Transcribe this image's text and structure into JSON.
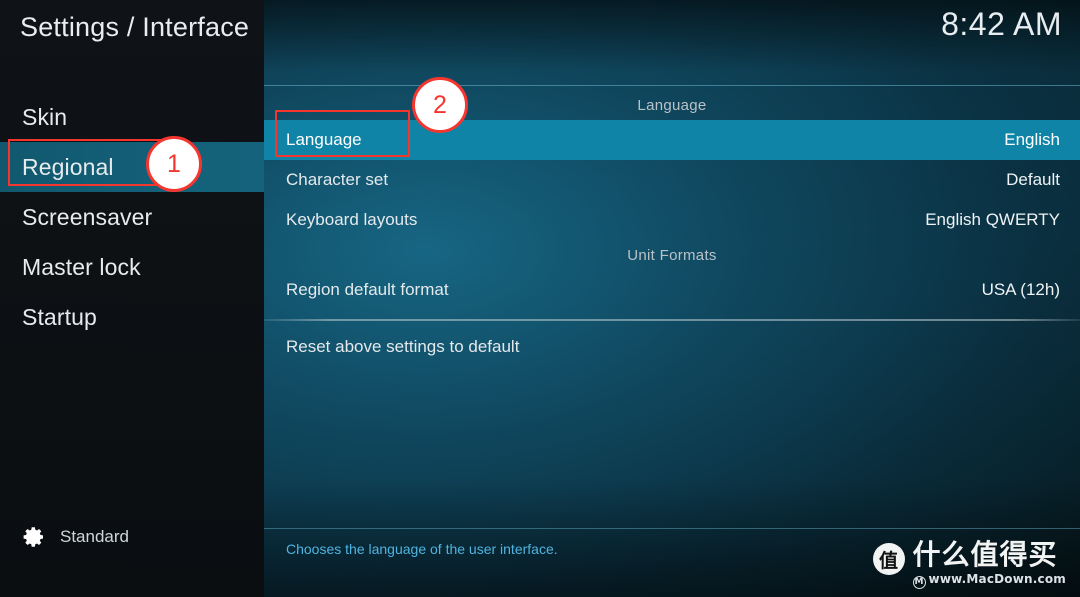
{
  "window": {
    "title": "Settings / Interface",
    "clock": "8:42 AM"
  },
  "sidebar": {
    "items": [
      {
        "label": "Skin",
        "selected": false
      },
      {
        "label": "Regional",
        "selected": true
      },
      {
        "label": "Screensaver",
        "selected": false
      },
      {
        "label": "Master lock",
        "selected": false
      },
      {
        "label": "Startup",
        "selected": false
      }
    ],
    "footer": {
      "icon": "gear-icon",
      "label": "Standard"
    }
  },
  "main": {
    "groups": [
      {
        "header": "Language",
        "rows": [
          {
            "label": "Language",
            "value": "English",
            "highlight": true
          },
          {
            "label": "Character set",
            "value": "Default",
            "highlight": false
          },
          {
            "label": "Keyboard layouts",
            "value": "English QWERTY",
            "highlight": false
          }
        ]
      },
      {
        "header": "Unit Formats",
        "rows": [
          {
            "label": "Region default format",
            "value": "USA (12h)",
            "highlight": false
          }
        ]
      }
    ],
    "reset_row": {
      "label": "Reset above settings to default",
      "value": ""
    },
    "description": "Chooses the language of the user interface."
  },
  "annotations": [
    {
      "number": "1",
      "target": "sidebar-item-regional"
    },
    {
      "number": "2",
      "target": "settings-row-language"
    }
  ],
  "watermark": {
    "badge": "值",
    "name": "什么值得买",
    "url": "www.MacDown.com",
    "url_mark": "M"
  },
  "colors": {
    "highlight": "#0f84a7",
    "sidebar_selected": "#14617a",
    "annotation_red": "#f4362f",
    "description_blue": "#4fb4e0"
  }
}
